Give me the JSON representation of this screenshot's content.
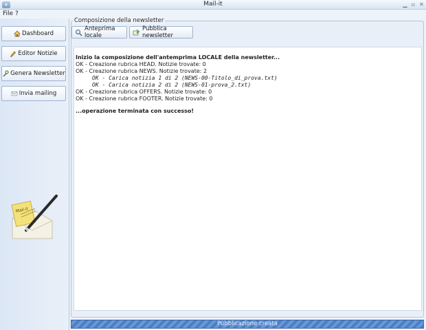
{
  "window": {
    "title": "Mail-it",
    "sysmenu_icon": "chevron-down-icon",
    "controls": [
      "minimize-icon",
      "maximize-icon",
      "close-icon"
    ]
  },
  "menu": {
    "file": "File",
    "help": "?"
  },
  "sidebar": {
    "items": [
      {
        "label": "Dashboard",
        "icon": "home-icon"
      },
      {
        "label": "Editor Notizie",
        "icon": "pencil-icon"
      },
      {
        "label": "Genera Newsletter",
        "icon": "wrench-icon"
      },
      {
        "label": "Invia mailing",
        "icon": "envelope-icon"
      }
    ],
    "logo_text": "Mail-it"
  },
  "panel": {
    "title": "Composizione della newsletter",
    "buttons": [
      {
        "label": "Anteprima locale",
        "icon": "magnifier-icon"
      },
      {
        "label": "Pubblica newsletter",
        "icon": "publish-icon"
      }
    ]
  },
  "log": {
    "lines": [
      "Inizio la composizione dell'antemprima LOCALE della newsletter...",
      "OK - Creazione rubrica HEAD. Notizie trovate: 0",
      "OK - Creazione rubrica NEWS. Notizie trovate: 2",
      "OK - Carica notizia 1 di 2 (NEWS-00-Titolo_di_prova.txt)",
      "OK - Carica notizia 2 di 2 (NEWS-01-prova_2.txt)",
      "OK - Creazione rubrica OFFERS. Notizie trovate: 0",
      "OK - Creazione rubrica FOOTER. Notizie trovate: 0",
      "...operazione terminata con successo!"
    ]
  },
  "status": {
    "text": "Pubblicazione creata"
  },
  "colors": {
    "status_bar": "#4a7fc6",
    "sidebar": "#dce7f5",
    "panel_border": "#b3c4da"
  }
}
